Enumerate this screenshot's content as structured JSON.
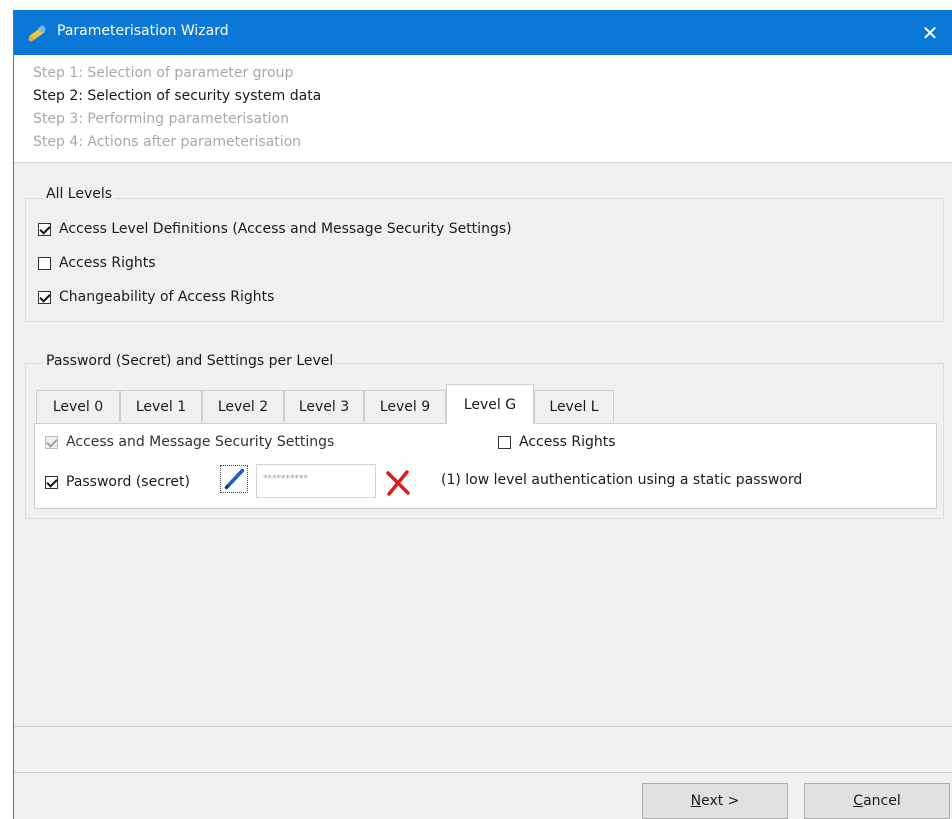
{
  "window": {
    "title": "Parameterisation Wizard",
    "close_glyph": "✕"
  },
  "steps": [
    {
      "label": "Step 1: Selection of parameter group",
      "active": false
    },
    {
      "label": "Step 2: Selection of security system data",
      "active": true
    },
    {
      "label": "Step 3: Performing parameterisation",
      "active": false
    },
    {
      "label": "Step 4: Actions after parameterisation",
      "active": false
    }
  ],
  "all_levels": {
    "title": "All Levels",
    "options": [
      {
        "label": "Access Level Definitions (Access and Message Security Settings)",
        "checked": true
      },
      {
        "label": "Access Rights",
        "checked": false
      },
      {
        "label": "Changeability of Access Rights",
        "checked": true
      }
    ]
  },
  "per_level": {
    "title": "Password (Secret) and Settings per Level",
    "tabs": [
      "Level 0",
      "Level 1",
      "Level 2",
      "Level 3",
      "Level 9",
      "Level G",
      "Level L"
    ],
    "active_tab": "Level G",
    "access_msg_settings": {
      "label": "Access and Message Security Settings",
      "checked": true,
      "disabled": true
    },
    "access_rights": {
      "label": "Access Rights",
      "checked": false
    },
    "password": {
      "label": "Password (secret)",
      "checked": true,
      "value": "**********"
    },
    "auth_hint": "(1) low level authentication using a static password"
  },
  "buttons": {
    "next": {
      "mnemonic": "N",
      "rest": "ext >"
    },
    "cancel": {
      "mnemonic": "C",
      "rest": "ancel"
    }
  },
  "colors": {
    "titlebar": "#0b78d7",
    "window_bg": "#f0f0f0",
    "delete_icon": "#e01b1b",
    "pen_icon": "#1f5fbf"
  }
}
